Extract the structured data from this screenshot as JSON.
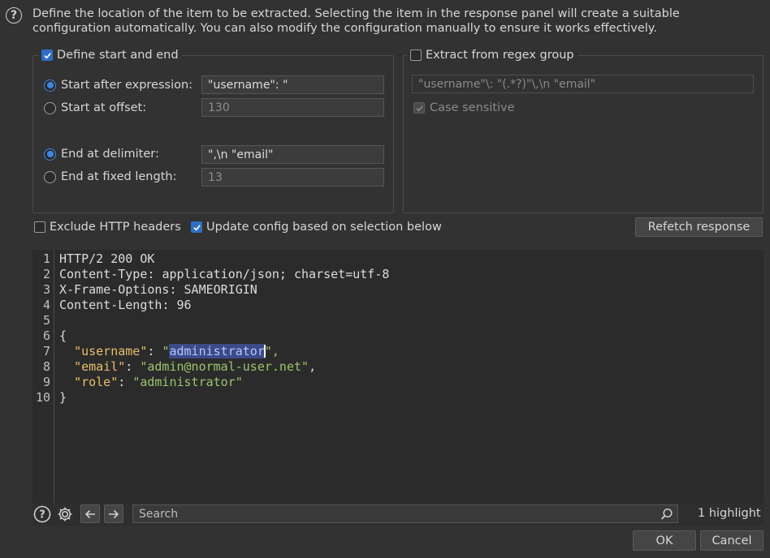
{
  "description": {
    "line1": "Define the location of the item to be extracted. Selecting the item in the response panel will create a suitable",
    "line2": "configuration automatically. You can also modify the configuration manually to ensure it works effectively."
  },
  "start_end_group": {
    "legend": "Define start and end",
    "checked": true,
    "start_after_label": "Start after expression:",
    "start_after_value": "\"username\": \"",
    "start_offset_label": "Start at offset:",
    "start_offset_value": "130",
    "end_delim_label": "End at delimiter:",
    "end_delim_value": "\",\\n  \"email\"",
    "end_fixed_label": "End at fixed length:",
    "end_fixed_value": "13"
  },
  "regex_group": {
    "legend": "Extract from regex group",
    "checked": false,
    "regex_value": "\"username\"\\: \"(.*?)\"\\,\\n  \"email\"",
    "case_sensitive_label": "Case sensitive",
    "case_sensitive_checked": true
  },
  "options": {
    "exclude_headers_label": "Exclude HTTP headers",
    "exclude_headers_checked": false,
    "update_config_label": "Update config based on selection below",
    "update_config_checked": true,
    "refetch_label": "Refetch response"
  },
  "response": {
    "line_numbers": [
      "1",
      "2",
      "3",
      "4",
      "5",
      "6",
      "7",
      "8",
      "9",
      "10"
    ],
    "status_line": "HTTP/2 200 OK",
    "headers": [
      {
        "name": "Content-Type",
        "value": "application/json; charset=utf-8"
      },
      {
        "name": "X-Frame-Options",
        "value": "SAMEORIGIN"
      },
      {
        "name": "Content-Length",
        "value": "96"
      }
    ],
    "open_brace": "{",
    "close_brace": "}",
    "fields": [
      {
        "key": "\"username\"",
        "value_open": "\"",
        "value_selected": "administrator",
        "value_close": "\","
      },
      {
        "key": "\"email\"",
        "value": "\"admin@normal-user.net\"",
        "trail": ","
      },
      {
        "key": "\"role\"",
        "value": "\"administrator\"",
        "trail": ""
      }
    ]
  },
  "search": {
    "placeholder": "Search",
    "highlight_count": "1 highlight"
  },
  "footer": {
    "ok_label": "OK",
    "cancel_label": "Cancel"
  },
  "icons": [
    "help-icon",
    "settings-icon",
    "back-arrow-icon",
    "forward-arrow-icon",
    "search-icon",
    "checkmark-icon"
  ],
  "colors": {
    "accent": "#2f6fc2",
    "json_key": "#e8bf6a",
    "json_string": "#9cc46c",
    "selection": "#3c4a8a"
  }
}
